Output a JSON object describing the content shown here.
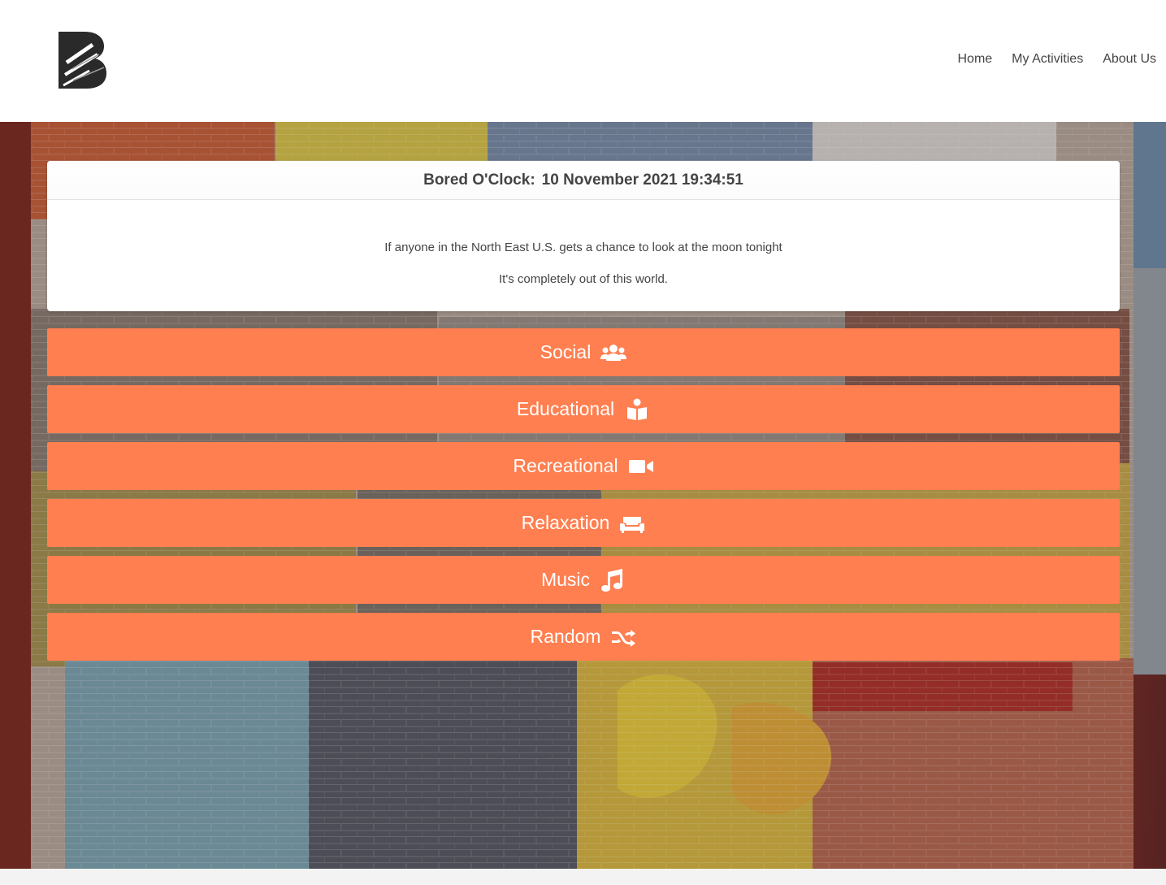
{
  "nav": {
    "links": [
      "Home",
      "My Activities",
      "About Us"
    ]
  },
  "card": {
    "title_prefix": "Bored O'Clock:",
    "timestamp": "10 November 2021 19:34:51",
    "line1": "If anyone in the North East U.S. gets a chance to look at the moon tonight",
    "line2": "It's completely out of this world."
  },
  "categories": [
    {
      "label": "Social",
      "icon": "users-icon"
    },
    {
      "label": "Educational",
      "icon": "book-reader-icon"
    },
    {
      "label": "Recreational",
      "icon": "video-icon"
    },
    {
      "label": "Relaxation",
      "icon": "couch-icon"
    },
    {
      "label": "Music",
      "icon": "music-icon"
    },
    {
      "label": "Random",
      "icon": "shuffle-icon"
    }
  ],
  "colors": {
    "button": "#ff7f50",
    "header_bg": "#ffffff"
  }
}
